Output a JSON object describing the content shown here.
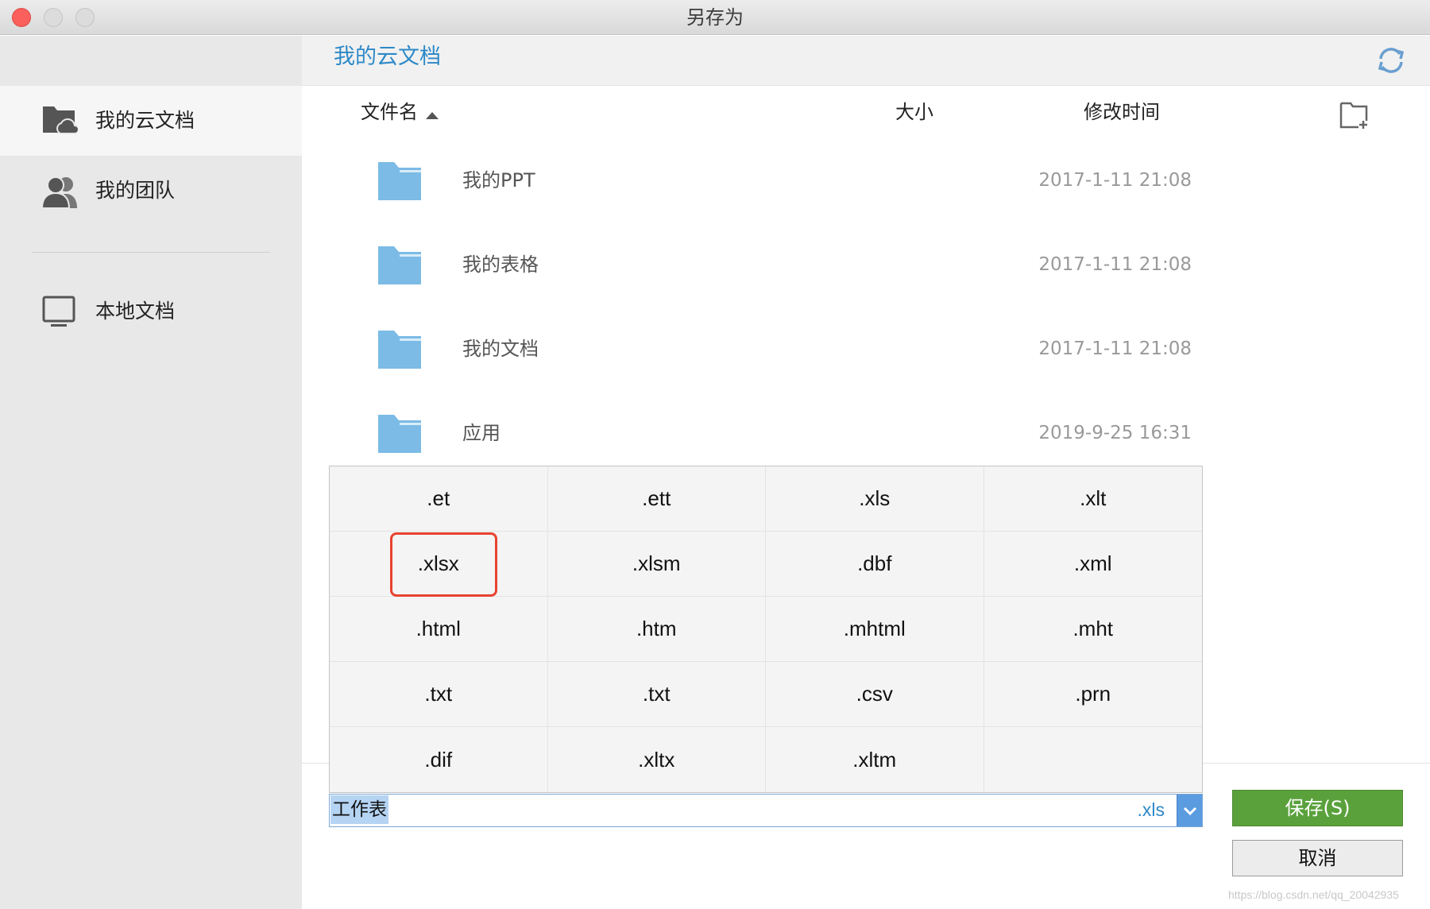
{
  "window": {
    "title": "另存为"
  },
  "sidebar": {
    "items": [
      {
        "label": "我的云文档",
        "icon": "cloud-folder-icon",
        "active": true
      },
      {
        "label": "我的团队",
        "icon": "team-icon",
        "active": false
      },
      {
        "label": "本地文档",
        "icon": "monitor-icon",
        "active": false
      }
    ]
  },
  "location": {
    "title": "我的云文档",
    "refresh_icon": "refresh-icon"
  },
  "columns": {
    "name": "文件名",
    "size": "大小",
    "modified": "修改时间"
  },
  "rows": [
    {
      "name": "我的PPT",
      "modified": "2017-1-11 21:08"
    },
    {
      "name": "我的表格",
      "modified": "2017-1-11 21:08"
    },
    {
      "name": "我的文档",
      "modified": "2017-1-11 21:08"
    },
    {
      "name": "应用",
      "modified": "2019-9-25 16:31"
    }
  ],
  "extensions": [
    ".et",
    ".ett",
    ".xls",
    ".xlt",
    ".xlsx",
    ".xlsm",
    ".dbf",
    ".xml",
    ".html",
    ".htm",
    ".mhtml",
    ".mht",
    ".txt",
    ".txt",
    ".csv",
    ".prn",
    ".dif",
    ".xltx",
    ".xltm",
    ""
  ],
  "highlighted_extension": ".xlsx",
  "filename": {
    "value": "工作表",
    "extension": ".xls"
  },
  "buttons": {
    "save": "保存(S)",
    "cancel": "取消"
  },
  "watermark": "https://blog.csdn.net/qq_20042935",
  "colors": {
    "accent": "#2d89c8",
    "save": "#5aa13c",
    "highlight": "#e8432f",
    "folder": "#7bbbe6"
  }
}
